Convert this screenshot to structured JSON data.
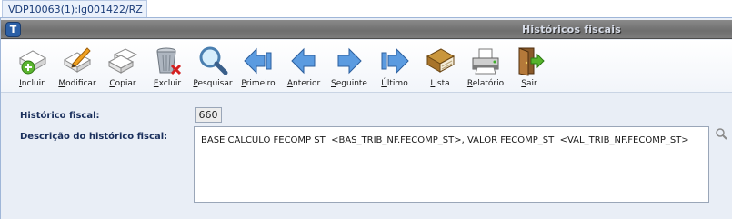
{
  "tab": {
    "label": "VDP10063(1):lg001422/RZ"
  },
  "window": {
    "title": "Históricos fiscais",
    "logo_letter": "T"
  },
  "toolbar": {
    "incluir": "Incluir",
    "modificar": "Modificar",
    "copiar": "Copiar",
    "excluir": "Excluir",
    "pesquisar": "Pesquisar",
    "primeiro": "Primeiro",
    "anterior": "Anterior",
    "seguinte": "Seguinte",
    "ultimo": "Último",
    "lista": "Lista",
    "relatorio": "Relatório",
    "sair": "Sair"
  },
  "form": {
    "historico_label": "Histórico fiscal:",
    "historico_value": "660",
    "descricao_label": "Descrição do histórico fiscal:",
    "descricao_value": "BASE CALCULO FECOMP ST  <BAS_TRIB_NF.FECOMP_ST>, VALOR FECOMP_ST  <VAL_TRIB_NF.FECOMP_ST>"
  },
  "colors": {
    "title_bar": "#7a7a7a",
    "form_bg": "#e9eef6",
    "label_text": "#1a2f5c",
    "nav_arrow": "#4f8fd6"
  },
  "icons": {
    "incluir": "add-document-icon",
    "modificar": "edit-document-icon",
    "copiar": "copy-document-icon",
    "excluir": "trash-icon",
    "pesquisar": "magnifier-icon",
    "primeiro": "first-arrow-icon",
    "anterior": "previous-arrow-icon",
    "seguinte": "next-arrow-icon",
    "ultimo": "last-arrow-icon",
    "lista": "book-icon",
    "relatorio": "printer-icon",
    "sair": "exit-door-icon"
  }
}
